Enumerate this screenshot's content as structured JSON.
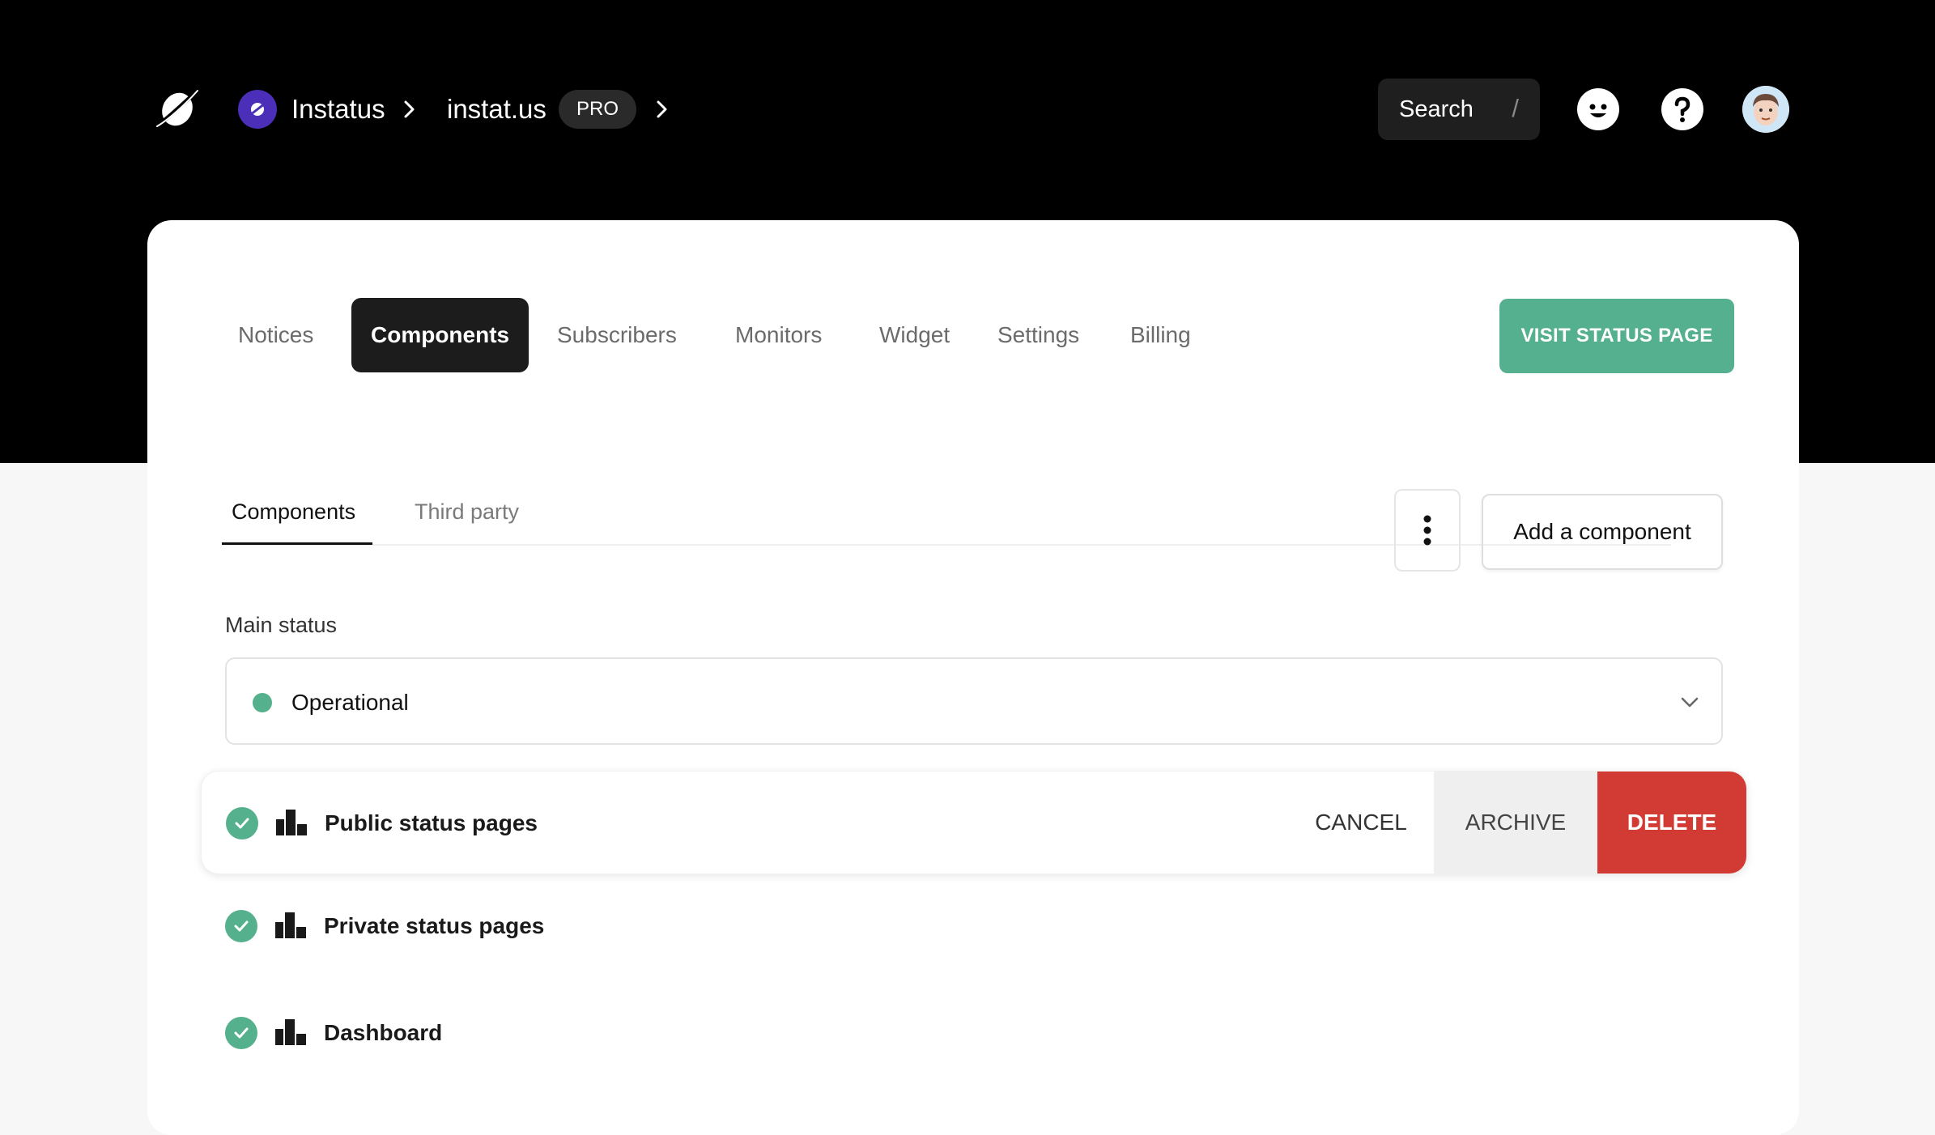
{
  "header": {
    "breadcrumb": [
      {
        "label": "Instatus"
      },
      {
        "label": "instat.us",
        "badge": "PRO"
      }
    ],
    "search": {
      "label": "Search",
      "shortcut": "/"
    },
    "icons": [
      "planet-logo-icon",
      "chevron-right-icon",
      "smiley-icon",
      "help-icon",
      "user-avatar"
    ]
  },
  "nav": {
    "tabs": [
      {
        "label": "Notices",
        "active": false
      },
      {
        "label": "Components",
        "active": true
      },
      {
        "label": "Subscribers",
        "active": false
      },
      {
        "label": "Monitors",
        "active": false
      },
      {
        "label": "Widget",
        "active": false
      },
      {
        "label": "Settings",
        "active": false
      },
      {
        "label": "Billing",
        "active": false
      }
    ],
    "visit_button": "VISIT STATUS PAGE"
  },
  "subtabs": [
    {
      "label": "Components",
      "active": true
    },
    {
      "label": "Third party",
      "active": false
    }
  ],
  "actions": {
    "add_component": "Add a component"
  },
  "main_status": {
    "label": "Main status",
    "value": "Operational",
    "color": "#55b08d"
  },
  "components": [
    {
      "label": "Public status pages",
      "status": "operational"
    },
    {
      "label": "Private status pages",
      "status": "operational"
    },
    {
      "label": "Dashboard",
      "status": "operational"
    }
  ],
  "row_actions": {
    "cancel": "CANCEL",
    "archive": "ARCHIVE",
    "delete": "DELETE"
  },
  "colors": {
    "accent_green": "#54b08f",
    "danger_red": "#d13b34",
    "header_bg": "#000000",
    "pro_badge_bg": "#2a2a2a",
    "breadcrumb_avatar": "#4b2fb8"
  }
}
